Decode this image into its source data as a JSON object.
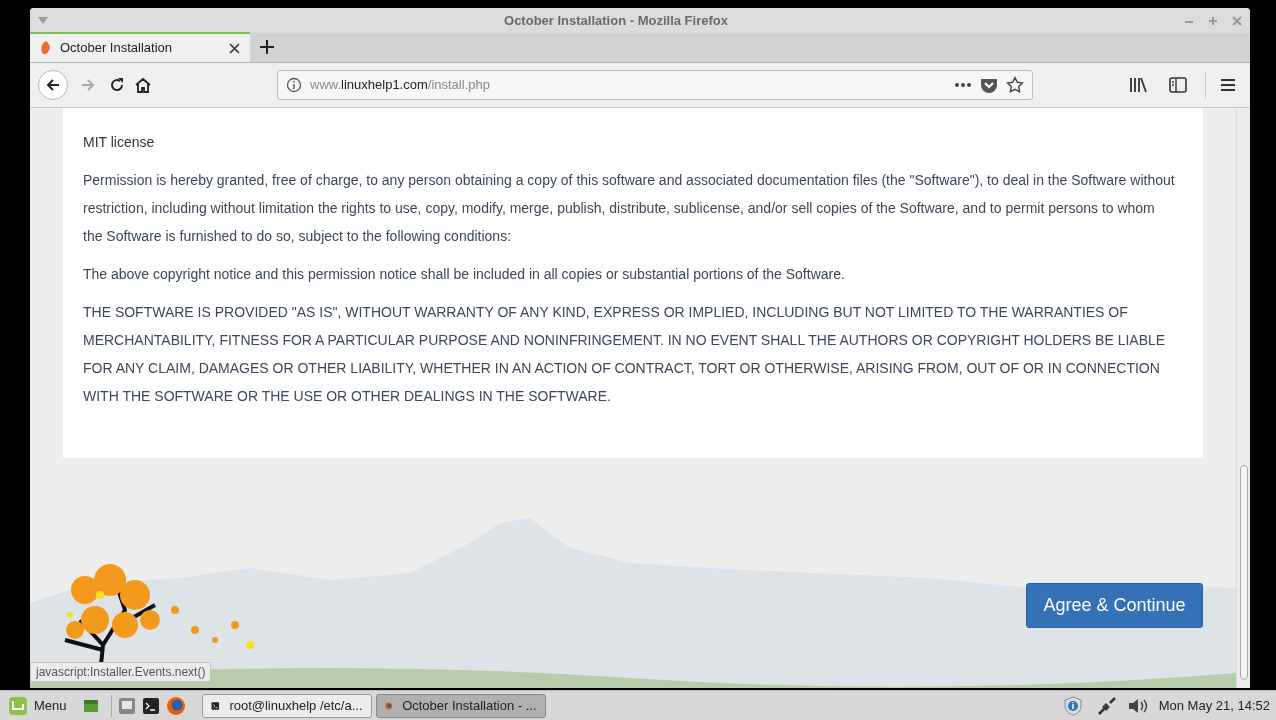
{
  "window": {
    "title": "October Installation - Mozilla Firefox"
  },
  "tabs": [
    {
      "label": "October Installation",
      "selected": true
    }
  ],
  "navigation": {
    "back_disabled": false,
    "forward_disabled": true
  },
  "address_bar": {
    "prefix": "www.",
    "domain": "linuxhelp1.com",
    "path": "/install.php"
  },
  "license": {
    "paragraphs": [
      {
        "kind": "heading",
        "text": "MIT license"
      },
      {
        "kind": "body",
        "text": "Permission is hereby granted, free of charge, to any person obtaining a copy of this software and associated documentation files (the \"Software\"), to deal in the Software without restriction, including without limitation the rights to use, copy, modify, merge, publish, distribute, sublicense, and/or sell copies of the Software, and to permit persons to whom the Software is furnished to do so, subject to the following conditions:"
      },
      {
        "kind": "body",
        "text": "The above copyright notice and this permission notice shall be included in all copies or substantial portions of the Software."
      },
      {
        "kind": "body",
        "text": "THE SOFTWARE IS PROVIDED \"AS IS\", WITHOUT WARRANTY OF ANY KIND, EXPRESS OR IMPLIED, INCLUDING BUT NOT LIMITED TO THE WARRANTIES OF MERCHANTABILITY, FITNESS FOR A PARTICULAR PURPOSE AND NONINFRINGEMENT. IN NO EVENT SHALL THE AUTHORS OR COPYRIGHT HOLDERS BE LIABLE FOR ANY CLAIM, DAMAGES OR OTHER LIABILITY, WHETHER IN AN ACTION OF CONTRACT, TORT OR OTHERWISE, ARISING FROM, OUT OF OR IN CONNECTION WITH THE SOFTWARE OR THE USE OR OTHER DEALINGS IN THE SOFTWARE."
      }
    ]
  },
  "primary_button": "Agree & Continue",
  "status_text": "javascript:Installer.Events.next()",
  "taskbar": {
    "menu_label": "Menu",
    "windows": [
      {
        "kind": "terminal",
        "label": "root@linuxhelp /etc/a...",
        "selected": false
      },
      {
        "kind": "browser",
        "label": "October Installation - ...",
        "selected": true
      }
    ],
    "clock": "Mon May 21, 14:52"
  }
}
